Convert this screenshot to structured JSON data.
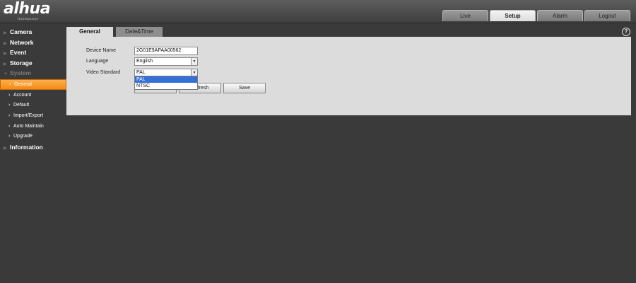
{
  "brand": {
    "logo_text": "alhua",
    "tagline": "TECHNOLOGY"
  },
  "top_tabs": [
    {
      "label": "Live",
      "active": false
    },
    {
      "label": "Setup",
      "active": true
    },
    {
      "label": "Alarm",
      "active": false
    },
    {
      "label": "Logout",
      "active": false
    }
  ],
  "sidebar": {
    "items": [
      {
        "label": "Camera"
      },
      {
        "label": "Network"
      },
      {
        "label": "Event"
      },
      {
        "label": "Storage"
      },
      {
        "label": "System",
        "expanded": true
      },
      {
        "label": "Information"
      }
    ],
    "system_children": [
      {
        "label": "General",
        "active": true
      },
      {
        "label": "Account"
      },
      {
        "label": "Default"
      },
      {
        "label": "Import/Export"
      },
      {
        "label": "Auto Maintain"
      },
      {
        "label": "Upgrade"
      }
    ]
  },
  "content_tabs": [
    {
      "label": "General",
      "active": true
    },
    {
      "label": "Date&Time",
      "active": false
    }
  ],
  "help_icon": "?",
  "form": {
    "device_name": {
      "label": "Device Name",
      "value": "2G01E9APAA00562"
    },
    "language": {
      "label": "Language",
      "value": "English"
    },
    "video_standard": {
      "label": "Video Standard",
      "value": "PAL",
      "options": [
        "PAL",
        "NTSC"
      ],
      "highlighted": "PAL"
    }
  },
  "buttons": {
    "default_label": "Default",
    "refresh_label": "Refresh",
    "save_label": "Save"
  },
  "colors": {
    "accent": "#f38a18",
    "panel": "#dcdcdc",
    "background": "#3a3a3a",
    "selection": "#3470d8"
  }
}
